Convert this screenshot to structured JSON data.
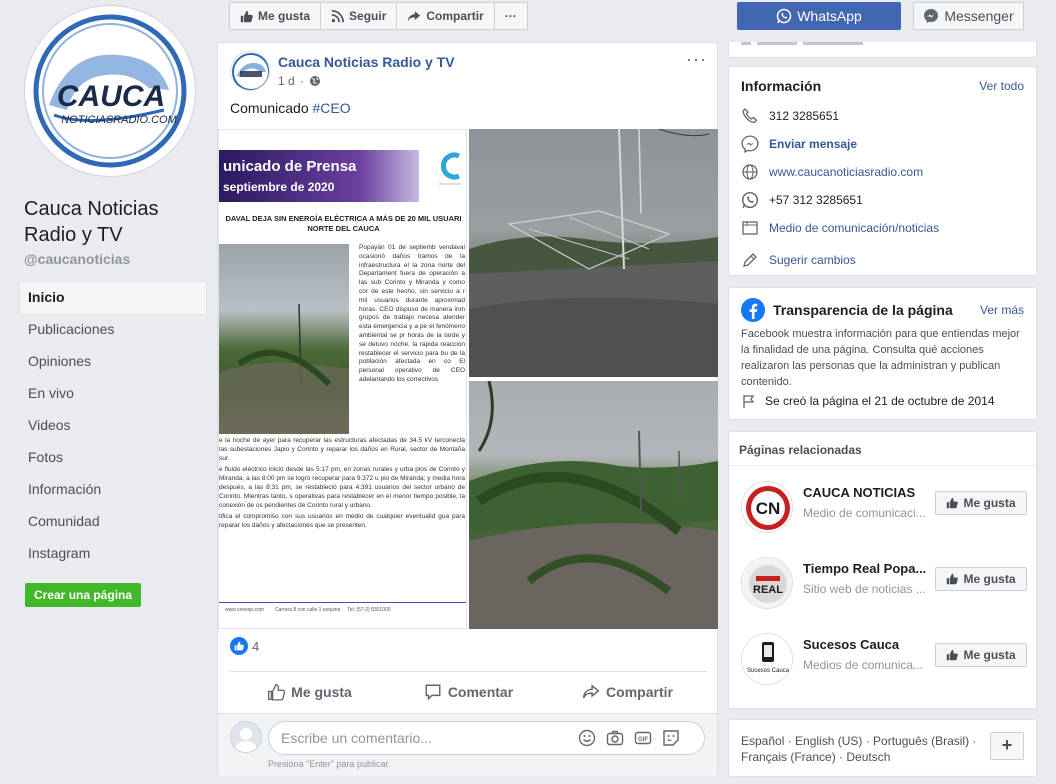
{
  "page": {
    "name": "Cauca Noticias Radio y TV",
    "handle": "@caucanoticias",
    "logo_text": "CAUCA",
    "logo_subtext": "NOTICIASRADIO.COM"
  },
  "left_nav": {
    "items": [
      "Inicio",
      "Publicaciones",
      "Opiniones",
      "En vivo",
      "Videos",
      "Fotos",
      "Información",
      "Comunidad",
      "Instagram"
    ],
    "active": "Inicio",
    "create_page": "Crear una página"
  },
  "action_bar": {
    "like": "Me gusta",
    "follow": "Seguir",
    "share": "Compartir",
    "more": "···",
    "whatsapp": "WhatsApp",
    "messenger": "Messenger"
  },
  "post": {
    "author": "Cauca Noticias Radio y TV",
    "time": "1 d",
    "text_prefix": "Comunicado ",
    "hashtag": "#CEO",
    "reaction_count": "4",
    "actions": {
      "like": "Me gusta",
      "comment": "Comentar",
      "share": "Compartir"
    },
    "comment_placeholder": "Escribe un comentario...",
    "comment_hint": "Presiona \"Enter\" para publicar.",
    "photo_doc": {
      "title_line1": "unicado de Prensa",
      "title_line2": "septiembre de 2020",
      "headline": "DAVAL DEJA SIN ENERGÍA ELÉCTRICA A MÁS DE 20 MIL USUARI",
      "headline2": "NORTE DEL CAUCA",
      "para1": "Popayán 01 de septiemb vendaval ocasionó daños tramos de la infraestructura el la zona norte del Departament fuera de operación a las sub Corinto y Miranda y como cor de este hecho, sin servicio a r mil usuarios durante aproximad horas.",
      "para2": "CEO dispuso de manera inm grupos de trabajo necesa atender esta emergencia y a pe el fenómeno ambiental se pr horas de la tarde y se detuvo noche, la rápida reacción restablecer el servicio para bu de la población afectada en co El personal operativo de CEO adelantando los correctivos",
      "para3": "e la noche de ayer para recuperar las estructuras afectadas de 34.5 kV terconecta las subestaciones Japio y Corinto y reparar los daños en Rural, sector de Montaña sur.",
      "para4": "e fluido eléctrico inició desde las 5:17 pm, en zonas rurales y urba pios de Corinto y Miranda, a las 8:00 pm se logró recuperar para 9.372 u pio de Miranda; y media hora después, a las 8:31 pm, se restableció para 4.391 usuarios del sector urbano de Corinto. Mientras tanto, s operativas para restablecer en el menor tiempo posible, la conexión de os pendientes de Corinto rural y urbano.",
      "para5": "tifica el compromiso con sus usuarios en medio de cualquier eventualid gua para reparar los daños y afectaciones que se presenten.",
      "footer": "www.ceoesp.com        Carrera 8 con calle 1 esquina     Tel: (57-2) 8301000"
    }
  },
  "info": {
    "title": "Información",
    "see_all": "Ver todo",
    "cut_top": "",
    "items": [
      {
        "icon": "phone-icon",
        "text": "312 3285651",
        "style": ""
      },
      {
        "icon": "messenger-icon",
        "text": "Enviar mensaje",
        "style": "bold"
      },
      {
        "icon": "globe-icon",
        "text": "www.caucanoticiasradio.com",
        "style": "link"
      },
      {
        "icon": "whatsapp-icon",
        "text": "+57 312 3285651",
        "style": ""
      },
      {
        "icon": "category-icon",
        "text": "Medio de comunicación/noticias",
        "style": "link"
      },
      {
        "icon": "pencil-icon",
        "text": "Sugerir cambios",
        "style": "link"
      }
    ]
  },
  "transparency": {
    "title": "Transparencia de la página",
    "see_more": "Ver más",
    "description": "Facebook muestra información para que entiendas mejor la finalidad de una página. Consulta qué acciones realizaron las personas que la administran y publican contenido.",
    "created": "Se creó la página el 21 de octubre de 2014"
  },
  "related": {
    "title": "Páginas relacionadas",
    "like_label": "Me gusta",
    "pages": [
      {
        "name": "CAUCA NOTICIAS",
        "subtitle": "Medio de comunicaci...",
        "logo": "CN"
      },
      {
        "name": "Tiempo Real Popa...",
        "subtitle": "Sitio web de noticias ...",
        "logo": "REAL"
      },
      {
        "name": "Sucesos Cauca",
        "subtitle": "Medios de comunica...",
        "logo": "Sucesos Cauca"
      }
    ]
  },
  "languages": {
    "text": "Español · English (US) · Português (Brasil) · Français (France) · Deutsch",
    "plus": "+"
  },
  "colors": {
    "brand_blue": "#4267b2",
    "link": "#365899",
    "green": "#42b72a",
    "like_blue": "#1877f2"
  }
}
